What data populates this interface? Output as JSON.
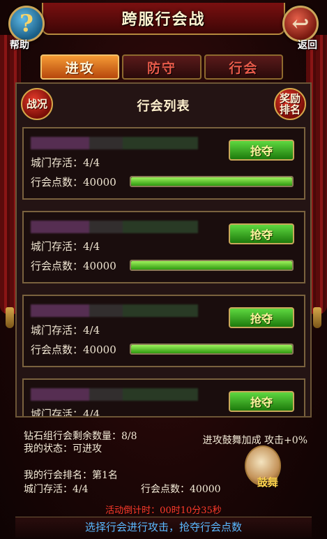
{
  "title": "跨服行会战",
  "help": {
    "icon": "question-mark-icon",
    "glyph": "?",
    "label": "帮助"
  },
  "back": {
    "icon": "back-arrow-icon",
    "glyph": "↩",
    "label": "返回"
  },
  "tabs": [
    {
      "label": "进攻",
      "active": true
    },
    {
      "label": "防守",
      "active": false
    },
    {
      "label": "行会",
      "active": false
    }
  ],
  "panel": {
    "war_status_label": "战况",
    "list_title": "行会列表",
    "reward_ranking_label": "奖励排名"
  },
  "guilds": [
    {
      "gate_text": "城门存活：4/4",
      "points_label": "行会点数：",
      "points": "40000",
      "progress_fraction": 1.0,
      "seize_label": "抢夺"
    },
    {
      "gate_text": "城门存活：4/4",
      "points_label": "行会点数：",
      "points": "40000",
      "progress_fraction": 1.0,
      "seize_label": "抢夺"
    },
    {
      "gate_text": "城门存活：4/4",
      "points_label": "行会点数：",
      "points": "40000",
      "progress_fraction": 1.0,
      "seize_label": "抢夺"
    },
    {
      "gate_text": "城门存活：4/4",
      "points_label": "",
      "points": "",
      "progress_fraction": null,
      "seize_label": "抢夺"
    }
  ],
  "info": {
    "diamond_remaining": "钻石组行会剩余数量：8/8",
    "my_state": "我的状态：可进攻",
    "my_rank": "我的行会排名：第1名",
    "gate_alive": "城门存活：4/4",
    "guild_points": "行会点数：40000",
    "attack_buff": "进攻鼓舞加成 攻击+0%",
    "drum_label": "鼓舞"
  },
  "countdown": "活动倒计时：00时10分35秒",
  "hint": "选择行会进行攻击，抢夺行会点数",
  "colors": {
    "seize_button": "#3cae22",
    "progress_fill": "#5fd32c",
    "hint": "#5ab8ff",
    "countdown": "#ff3b2b"
  }
}
